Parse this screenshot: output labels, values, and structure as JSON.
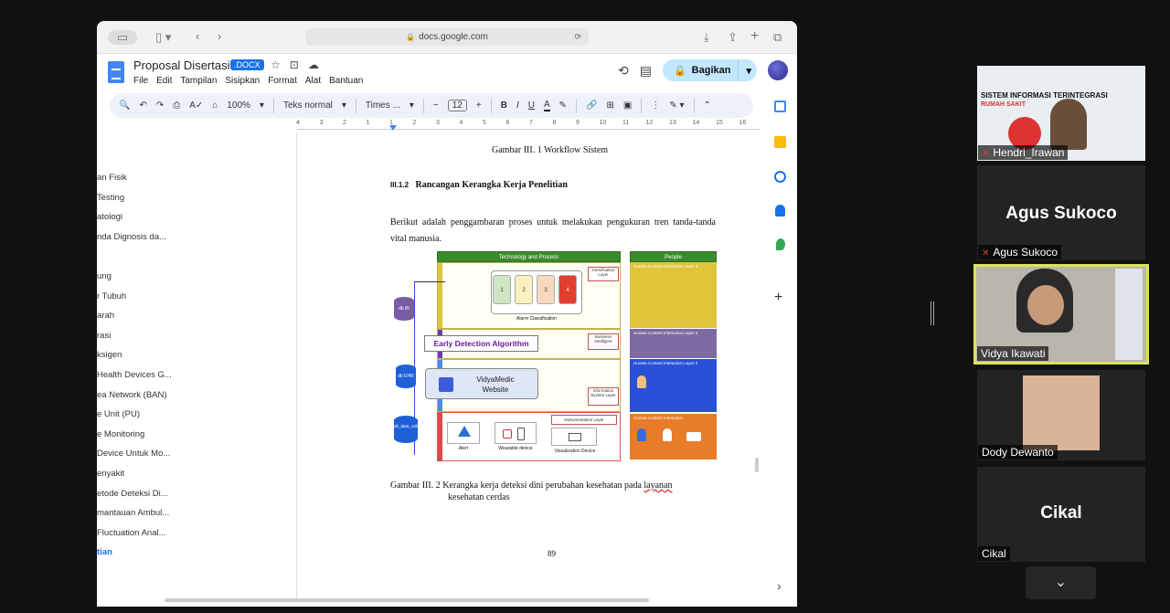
{
  "browser": {
    "url": "docs.google.com"
  },
  "doc": {
    "title": "Proposal Disertasi",
    "badge": ".DOCX",
    "menu": [
      "File",
      "Edit",
      "Tampilan",
      "Sisipkan",
      "Format",
      "Alat",
      "Bantuan"
    ],
    "share_label": "Bagikan"
  },
  "toolbar": {
    "zoom": "100%",
    "style": "Teks normal",
    "font": "Times ...",
    "font_size": "12"
  },
  "ruler": [
    "4",
    "3",
    "2",
    "1",
    "1",
    "2",
    "3",
    "4",
    "5",
    "6",
    "7",
    "8",
    "9",
    "10",
    "11",
    "12",
    "13",
    "14",
    "15",
    "16"
  ],
  "outline": [
    "an Fisik",
    "Testing",
    "atologi",
    "nda Dignosis da...",
    "",
    "ung",
    "r Tubuh",
    "arah",
    "rasi",
    "ksigen",
    "Health Devices G...",
    "ea Network (BAN)",
    "e Unit (PU)",
    "e Monitoring",
    "Device Untuk Mo...",
    "enyakit",
    "etode Deteksi Di...",
    "mantauan Ambul...",
    "Fluctuation Anal...",
    "tian"
  ],
  "page": {
    "caption1": "Gambar III. 1 Workflow Sistem",
    "heading_num": "III.1.2",
    "heading_text": "Rancangan Kerangka Kerja Penelitian",
    "paragraph": "Berikut adalah penggambaran proses untuk melakukan pengukuran tren tanda-tanda vital manusia.",
    "caption2_line1": "Gambar III. 2 Kerangka kerja deteksi dini perubahan kesehatan pada",
    "caption2_underlined": "layanan",
    "caption2_line2": "kesehatan cerdas",
    "page_number": "89"
  },
  "figure": {
    "tech_title": "Technology and Process",
    "people_title": "People",
    "alarm_levels": [
      "1",
      "2",
      "3",
      "4"
    ],
    "alarm_colors": [
      "#cfe6c4",
      "#fbf0c0",
      "#f8d9bf",
      "#e53d2f"
    ],
    "alarm_label": "Alarm Classification",
    "gamification": "Gamification Layer",
    "eda": "Early Detection Algorithm",
    "business": "Business Intelligent",
    "vidyamedic": "VidyaMedic Website",
    "info_layer": "Information System Layer",
    "instr_layer": "Instrumentation Layer",
    "alert": "Alert",
    "wearable": "Wearable device",
    "visualization": "Visualization Device",
    "db_bi": "db BI",
    "db_ehr": "db EHR",
    "db_collection": "db_data_collection",
    "people_layers": [
      "Human-Content Interaction Layer 4",
      "Human-Content Interaction Layer 3",
      "Human-Content Interaction Layer 2",
      "Human-Content Interaction"
    ],
    "people_colors": [
      "#e0c43a",
      "#7c6aa0",
      "#2a4fd8",
      "#e97c2a"
    ],
    "actors": [
      "Doctor",
      "Patient",
      "Doctor",
      "Ambulance"
    ]
  },
  "participants": [
    {
      "name": "Hendri_Irawan",
      "muted": true,
      "banner": "SISTEM INFORMASI TERINTEGRASI",
      "banner_sub": "RUMAH SAKIT"
    },
    {
      "name": "Agus Sukoco",
      "muted": true,
      "big": "Agus Sukoco"
    },
    {
      "name": "Vidya Ikawati",
      "muted": false,
      "active_speaker": true
    },
    {
      "name": "Dody Dewanto",
      "muted": false
    },
    {
      "name": "Cikal",
      "muted": false,
      "big": "Cikal"
    }
  ]
}
